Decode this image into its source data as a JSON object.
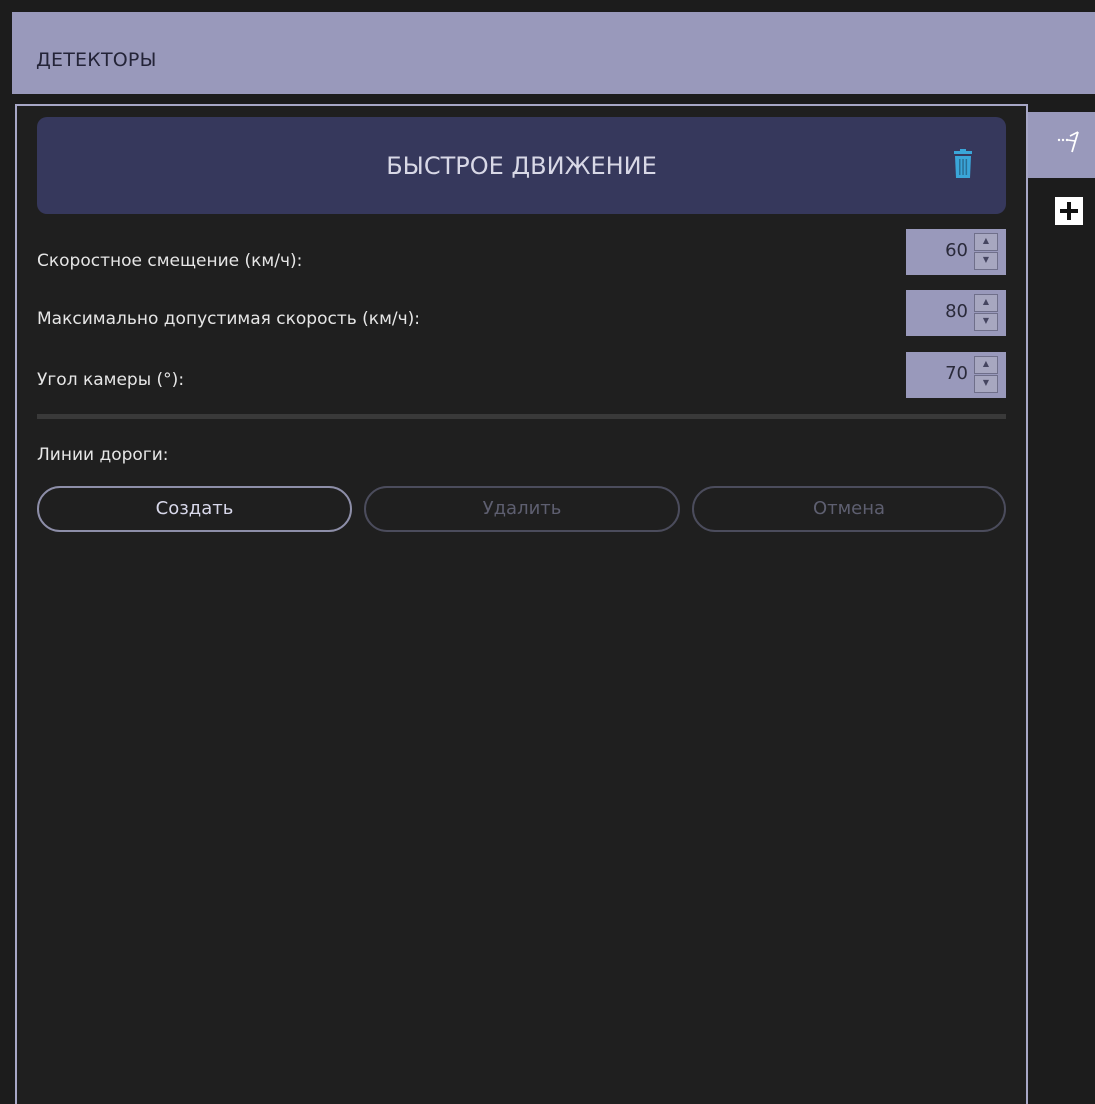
{
  "header": {
    "title": "ДЕТЕКТОРЫ"
  },
  "detector": {
    "title": "БЫСТРОЕ ДВИЖЕНИЕ",
    "delete_icon": "trash-icon"
  },
  "fields": [
    {
      "label": "Скоростное смещение (км/ч):",
      "value": "60"
    },
    {
      "label": "Максимально допустимая скорость (км/ч):",
      "value": "80"
    },
    {
      "label": "Угол камеры (°):",
      "value": "70"
    }
  ],
  "road_lines": {
    "label": "Линии дороги:",
    "buttons": [
      {
        "label": "Создать",
        "enabled": true
      },
      {
        "label": "Удалить",
        "enabled": false
      },
      {
        "label": "Отмена",
        "enabled": false
      }
    ]
  },
  "sidebar": {
    "active_tab_icon": "speed-detector-icon",
    "add_icon": "plus-icon"
  },
  "colors": {
    "header_bg": "#9999bb",
    "detector_header_bg": "#36385c",
    "trash_icon": "#3aa5d8",
    "panel_border": "#a7a7c6",
    "background": "#1f1f1f"
  }
}
